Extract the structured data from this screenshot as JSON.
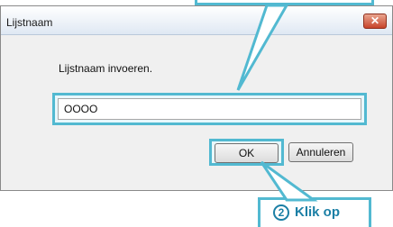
{
  "dialog": {
    "title": "Lijstnaam",
    "close_glyph": "✕",
    "prompt": "Lijstnaam invoeren.",
    "input_value": "OOOO",
    "ok_label": "OK",
    "cancel_label": "Annuleren"
  },
  "callout": {
    "step_number": "2",
    "step_label": "Klik op"
  },
  "colors": {
    "accent": "#52b9d1",
    "callout_text": "#1b7fa5"
  },
  "icons": {
    "close": "close-icon"
  }
}
